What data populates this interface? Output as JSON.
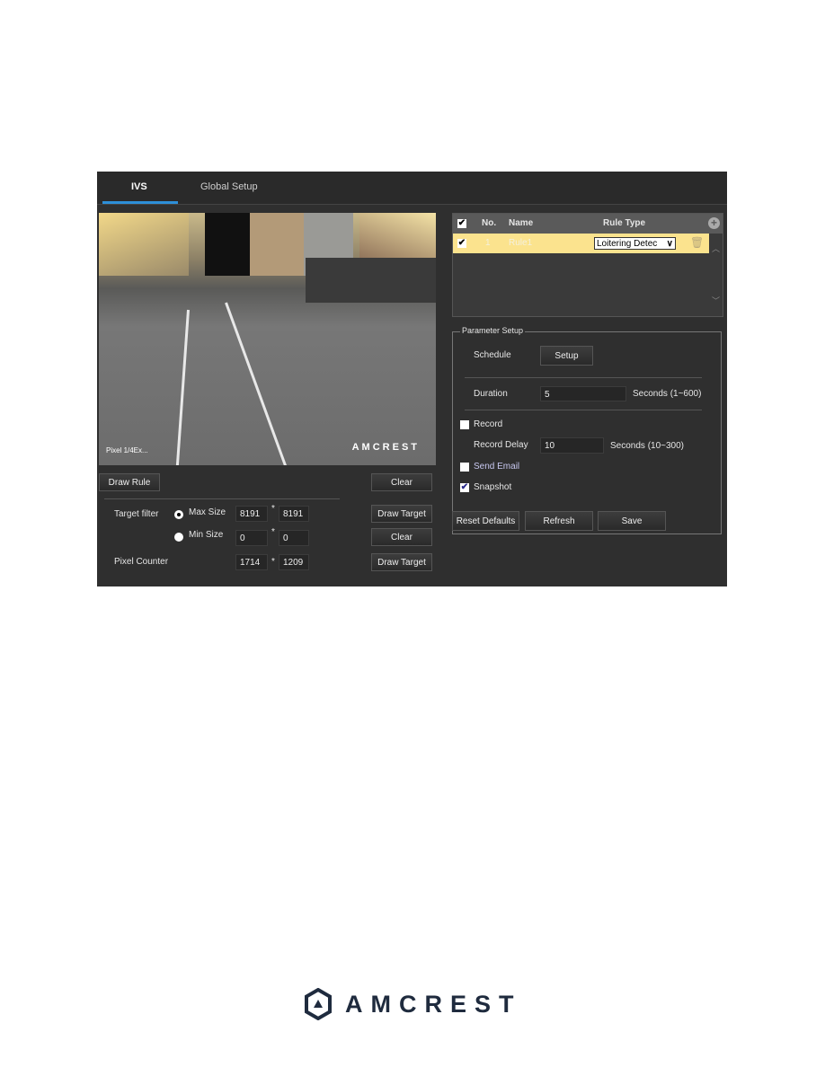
{
  "tabs": [
    {
      "label": "IVS",
      "active": true
    },
    {
      "label": "Global Setup",
      "active": false
    }
  ],
  "video": {
    "timestamp": "Pixel 1/4Ex...",
    "watermark": "AMCREST"
  },
  "left_controls": {
    "draw_rule": "Draw Rule",
    "clear_1": "Clear",
    "draw_target_1": "Draw Target",
    "clear_2": "Clear",
    "draw_target_2": "Draw Target",
    "target_filter_label": "Target filter",
    "max_size_label": "Max Size",
    "max_w": "8191",
    "max_h": "8191",
    "min_size_label": "Min Size",
    "min_w": "0",
    "min_h": "0",
    "pixel_counter_label": "Pixel Counter",
    "pc_w": "1714",
    "pc_h": "1209",
    "sep": "*",
    "selected_filter": "Max Size"
  },
  "rule_list": {
    "headers": {
      "no": "No.",
      "name": "Name",
      "rule_type": "Rule Type"
    },
    "rows": [
      {
        "checked": true,
        "no": "1",
        "name": "Rule1",
        "rule_type": "Loitering Detec"
      }
    ]
  },
  "parameter_setup": {
    "legend": "Parameter Setup",
    "schedule_label": "Schedule",
    "setup_button": "Setup",
    "duration_label": "Duration",
    "duration_value": "5",
    "duration_unit": "Seconds (1~600)",
    "record_label": "Record",
    "record_checked": false,
    "record_delay_label": "Record Delay",
    "record_delay_value": "10",
    "record_delay_unit": "Seconds (10~300)",
    "send_email_label": "Send Email",
    "send_email_checked": false,
    "snapshot_label": "Snapshot",
    "snapshot_checked": true
  },
  "actions": {
    "reset": "Reset Defaults",
    "refresh": "Refresh",
    "save": "Save"
  },
  "footer": {
    "brand": "AMCREST"
  },
  "colors": {
    "accent": "#2d8fd8",
    "row_highlight": "#fbe38e",
    "panel_bg": "#2f2f2f"
  }
}
